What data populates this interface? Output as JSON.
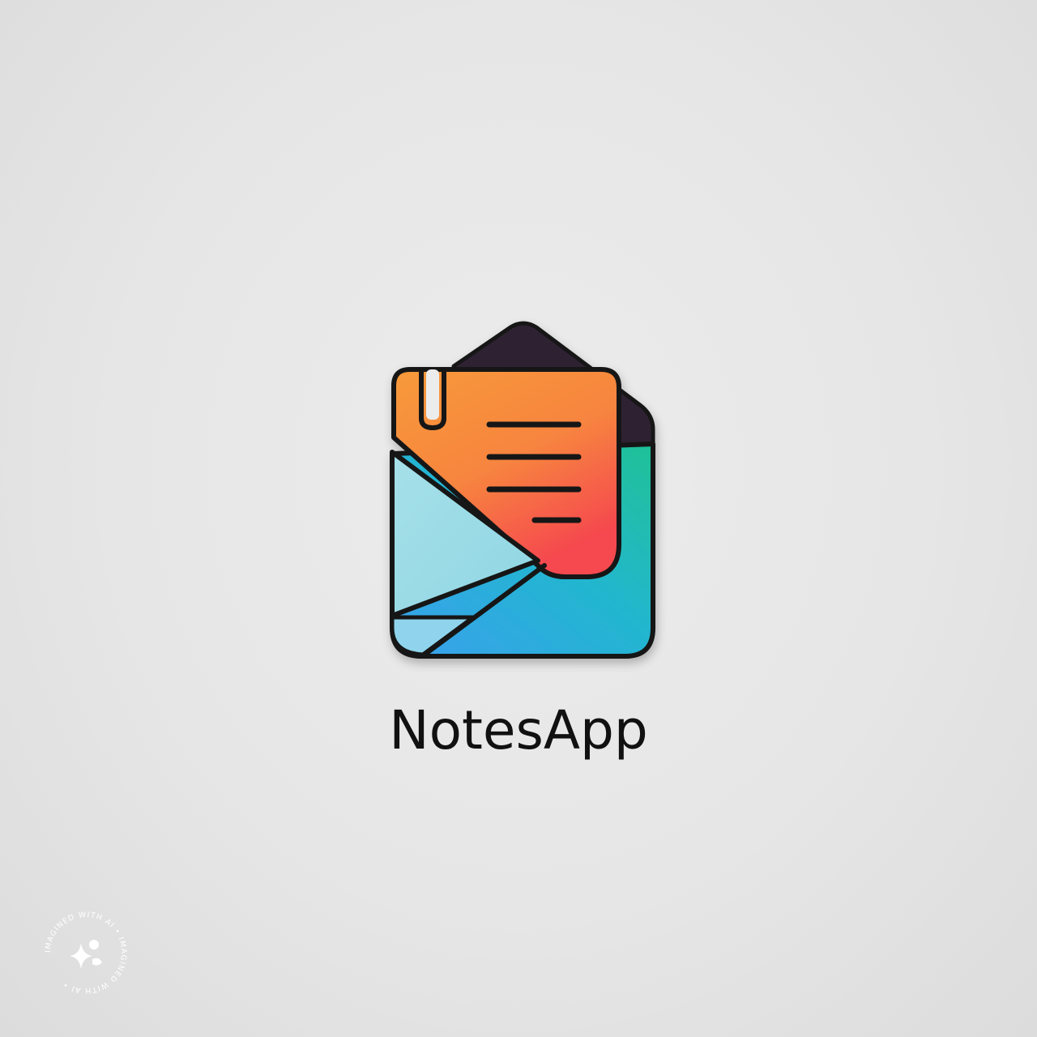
{
  "app": {
    "name": "NotesApp"
  },
  "icon": {
    "name": "notes-envelope-icon",
    "colors": {
      "note_top": "#f79a3a",
      "note_bottom": "#f5484f",
      "flap_light": "#9fdde6",
      "envelope_blue": "#3aa6ea",
      "envelope_teal": "#1fbf9a",
      "back_dark": "#2e2430",
      "outline": "#141414"
    }
  },
  "watermark": {
    "text": "IMAGINED WITH AI • IMAGINED WITH AI •",
    "icon": "sparkle-icon"
  }
}
